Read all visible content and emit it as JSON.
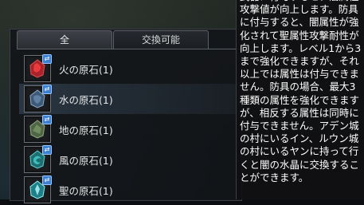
{
  "tabs": [
    {
      "label": "全",
      "active": true
    },
    {
      "label": "交換可能",
      "active": false
    }
  ],
  "items": [
    {
      "name": "火の原石(1)",
      "icon": "fire-stone-icon",
      "color": "#c23030"
    },
    {
      "name": "水の原石(1)",
      "icon": "water-stone-icon",
      "color": "#4d6d8e"
    },
    {
      "name": "地の原石(1)",
      "icon": "earth-stone-icon",
      "color": "#5f7a52"
    },
    {
      "name": "風の原石(1)",
      "icon": "wind-stone-icon",
      "color": "#2f9a9a"
    },
    {
      "name": "聖の原石(1)",
      "icon": "holy-stone-icon",
      "color": "#3bb8c0"
    }
  ],
  "badge_symbol": "⇄",
  "tooltip": {
    "text": "武器に付与すると、闇属性攻撃値が向上します。防具に付与すると、闇属性が強化されて聖属性攻撃耐性が向上します。レベル1から3まで強化できますが、それ以上では属性は付与できません。防具の場合、最大3種類の属性を強化できますが、相反する属性は同時に付与できません。アデン城の村にいるイン、ルウン城の村にいるヤンに持って行くと闇の水晶に交換することができます。"
  },
  "colors": {
    "highlight_row": "#4b6a88",
    "badge": "#3d7fd0"
  }
}
